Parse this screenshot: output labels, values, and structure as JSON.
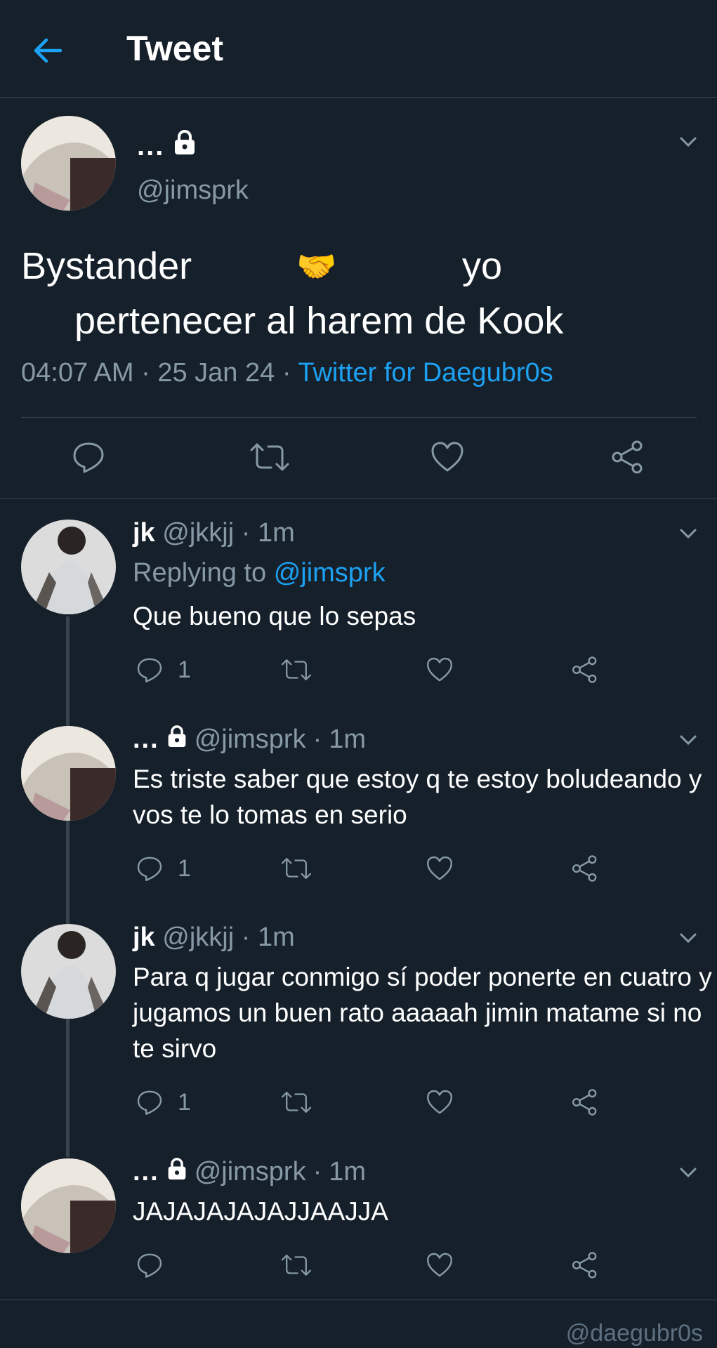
{
  "header": {
    "title": "Tweet"
  },
  "main_tweet": {
    "name": "...",
    "handle": "@jimsprk",
    "text_line1_a": "Bystander",
    "text_line1_emoji": "🤝",
    "text_line1_b": "yo",
    "text_line2": "pertenecer al harem de Kook",
    "time": "04:07 AM",
    "date": "25 Jan 24",
    "source": "Twitter for Daegubr0s"
  },
  "replies": [
    {
      "name": "jk",
      "handle": "@jkkjj",
      "time": "1m",
      "replying_label": "Replying to",
      "replying_to": "@jimsprk",
      "text": "Que bueno que lo sepas",
      "reply_count": "1"
    },
    {
      "name": "...",
      "handle": "@jimsprk",
      "time": "1m",
      "text": "Es triste saber que estoy q te estoy boludeando y vos te lo tomas en serio",
      "reply_count": "1"
    },
    {
      "name": "jk",
      "handle": "@jkkjj",
      "time": "1m",
      "text": "Para q jugar conmigo sí poder ponerte en cuatro y jugamos un buen rato aaaaah jimin matame si no te sirvo",
      "reply_count": "1"
    },
    {
      "name": "...",
      "handle": "@jimsprk",
      "time": "1m",
      "text": "JAJAJAJAJAJJAAJJA",
      "reply_count": ""
    }
  ],
  "watermark": "@daegubr0s",
  "colors": {
    "background": "#15202b",
    "accent": "#1da1f2",
    "muted": "#8899a6",
    "divider": "#38444d"
  }
}
